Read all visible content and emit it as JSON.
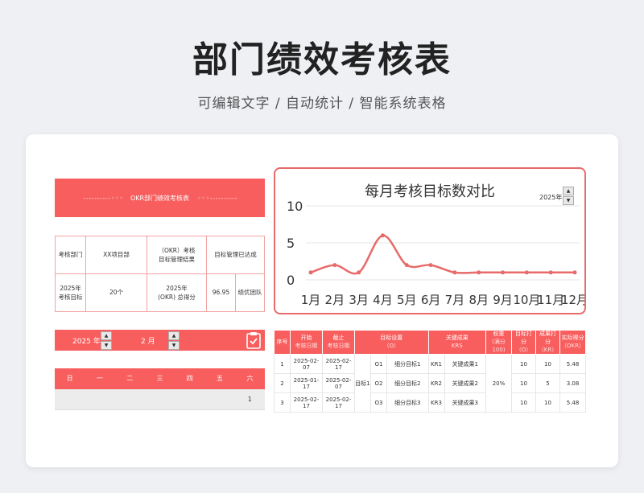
{
  "header": {
    "title": "部门绩效考核表",
    "subtitle": "可编辑文字 / 自动统计 / 智能系统表格"
  },
  "banner": {
    "deco_left": "- - - - - - - - - - ◦ ◦ ◦",
    "title": "OKR部门绩效考核表",
    "deco_right": "◦ ◦ ◦ - - - - - - - - - -"
  },
  "summary": {
    "row1": [
      "考核部门",
      "XX项目部",
      "（OKR）考核\n目标管理结果",
      "目标管理已达成"
    ],
    "row2": [
      "2025年\n考核目标",
      "20个",
      "2025年\n(OKR) 总得分",
      "96.95",
      "绩优团队"
    ]
  },
  "chart_panel": {
    "year_value": "2025年",
    "up_glyph": "▲",
    "down_glyph": "▼"
  },
  "chart_data": {
    "type": "line",
    "title": "每月考核目标数对比",
    "categories": [
      "1月",
      "2月",
      "3月",
      "4月",
      "5月",
      "6月",
      "7月",
      "8月",
      "9月",
      "10月",
      "11月",
      "12月"
    ],
    "values": [
      1,
      2,
      1,
      6,
      2,
      2,
      1,
      1,
      1,
      1,
      1,
      1
    ],
    "ylim": [
      0,
      10
    ],
    "yticks": [
      "0",
      "5",
      "10"
    ],
    "grid": true,
    "color": "#e86a6a"
  },
  "date_bar": {
    "year": "2025 年",
    "month": "2 月"
  },
  "calendar": {
    "weekdays": [
      "日",
      "一",
      "二",
      "三",
      "四",
      "五",
      "六"
    ],
    "row1": [
      "",
      "",
      "",
      "",
      "",
      "",
      "1"
    ]
  },
  "okr_table": {
    "headers": {
      "seq": "序号",
      "start_a": "开始",
      "start_b": "考核日期",
      "end_a": "截止",
      "end_b": "考核日期",
      "obj_a": "目标设置",
      "obj_b": "（O）",
      "kr_a": "关键成果",
      "kr_b": "KRS",
      "weight_a": "权重",
      "weight_b": "(满分100)",
      "o_a": "目标打分",
      "o_b": "（O）",
      "krs_a": "成果打分",
      "krs_b": "（KR）",
      "act_a": "实际得分",
      "act_b": "（OKR）"
    },
    "group_label": "目标1",
    "weight": "20%",
    "rows": [
      {
        "seq": "1",
        "start": "2025-02-07",
        "end": "2025-02-17",
        "o": "O1",
        "sub": "细分目标1",
        "kr": "KR1",
        "result": "关键成果1",
        "o_score": "10",
        "kr_score": "10",
        "actual": "5.48"
      },
      {
        "seq": "2",
        "start": "2025-01-17",
        "end": "2025-02-07",
        "o": "O2",
        "sub": "细分目标2",
        "kr": "KR2",
        "result": "关键成果2",
        "o_score": "10",
        "kr_score": "5",
        "actual": "3.08"
      },
      {
        "seq": "3",
        "start": "2025-02-17",
        "end": "2025-02-17",
        "o": "O3",
        "sub": "细分目标3",
        "kr": "KR3",
        "result": "关键成果3",
        "o_score": "10",
        "kr_score": "10",
        "actual": "5.48"
      }
    ]
  },
  "colors": {
    "accent": "#f85e5e",
    "chart_line": "#e86a6a",
    "border": "#f2a3a3"
  }
}
